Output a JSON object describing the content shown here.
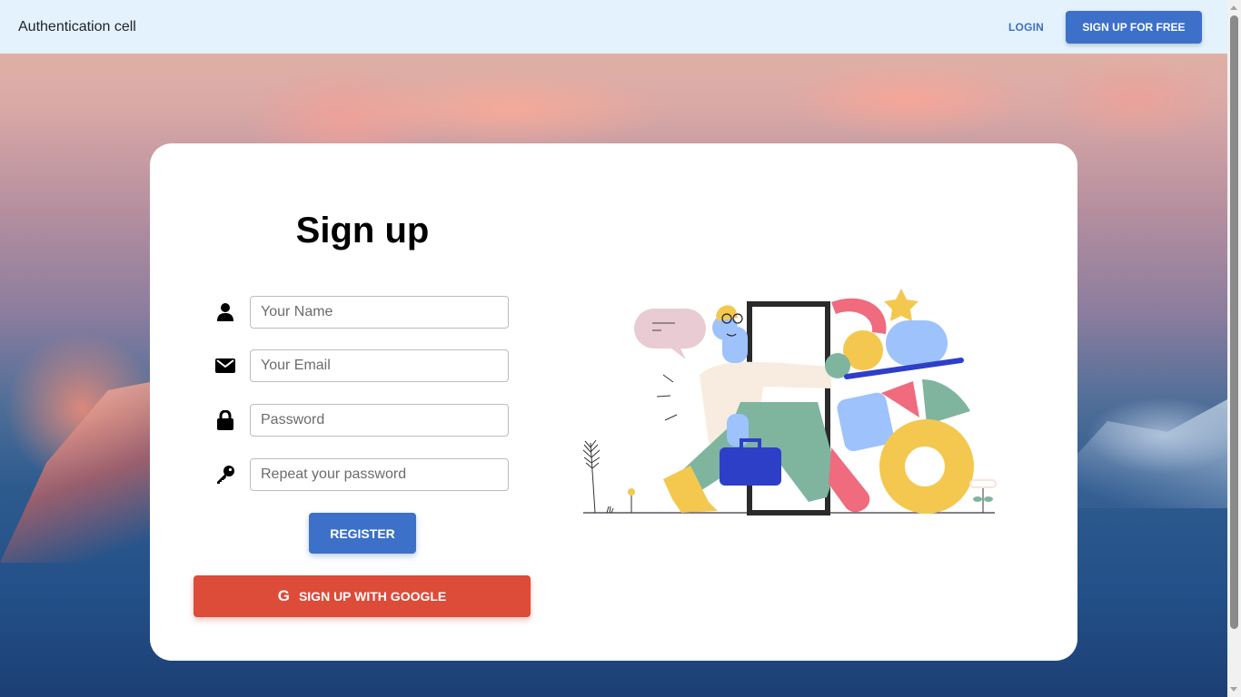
{
  "navbar": {
    "brand": "Authentication cell",
    "login_label": "LOGIN",
    "signup_label": "SIGN UP FOR FREE"
  },
  "form": {
    "title": "Sign up",
    "fields": [
      {
        "icon": "user-icon",
        "placeholder": "Your Name",
        "value": ""
      },
      {
        "icon": "envelope-icon",
        "placeholder": "Your Email",
        "value": ""
      },
      {
        "icon": "lock-icon",
        "placeholder": "Password",
        "value": ""
      },
      {
        "icon": "key-icon",
        "placeholder": "Repeat your password",
        "value": ""
      }
    ],
    "register_label": "REGISTER",
    "google_label": "SIGN UP WITH GOOGLE",
    "google_icon": "G"
  },
  "colors": {
    "navbar_bg": "#e3f2fd",
    "primary": "#3d70c9",
    "google": "#dd4b39"
  }
}
